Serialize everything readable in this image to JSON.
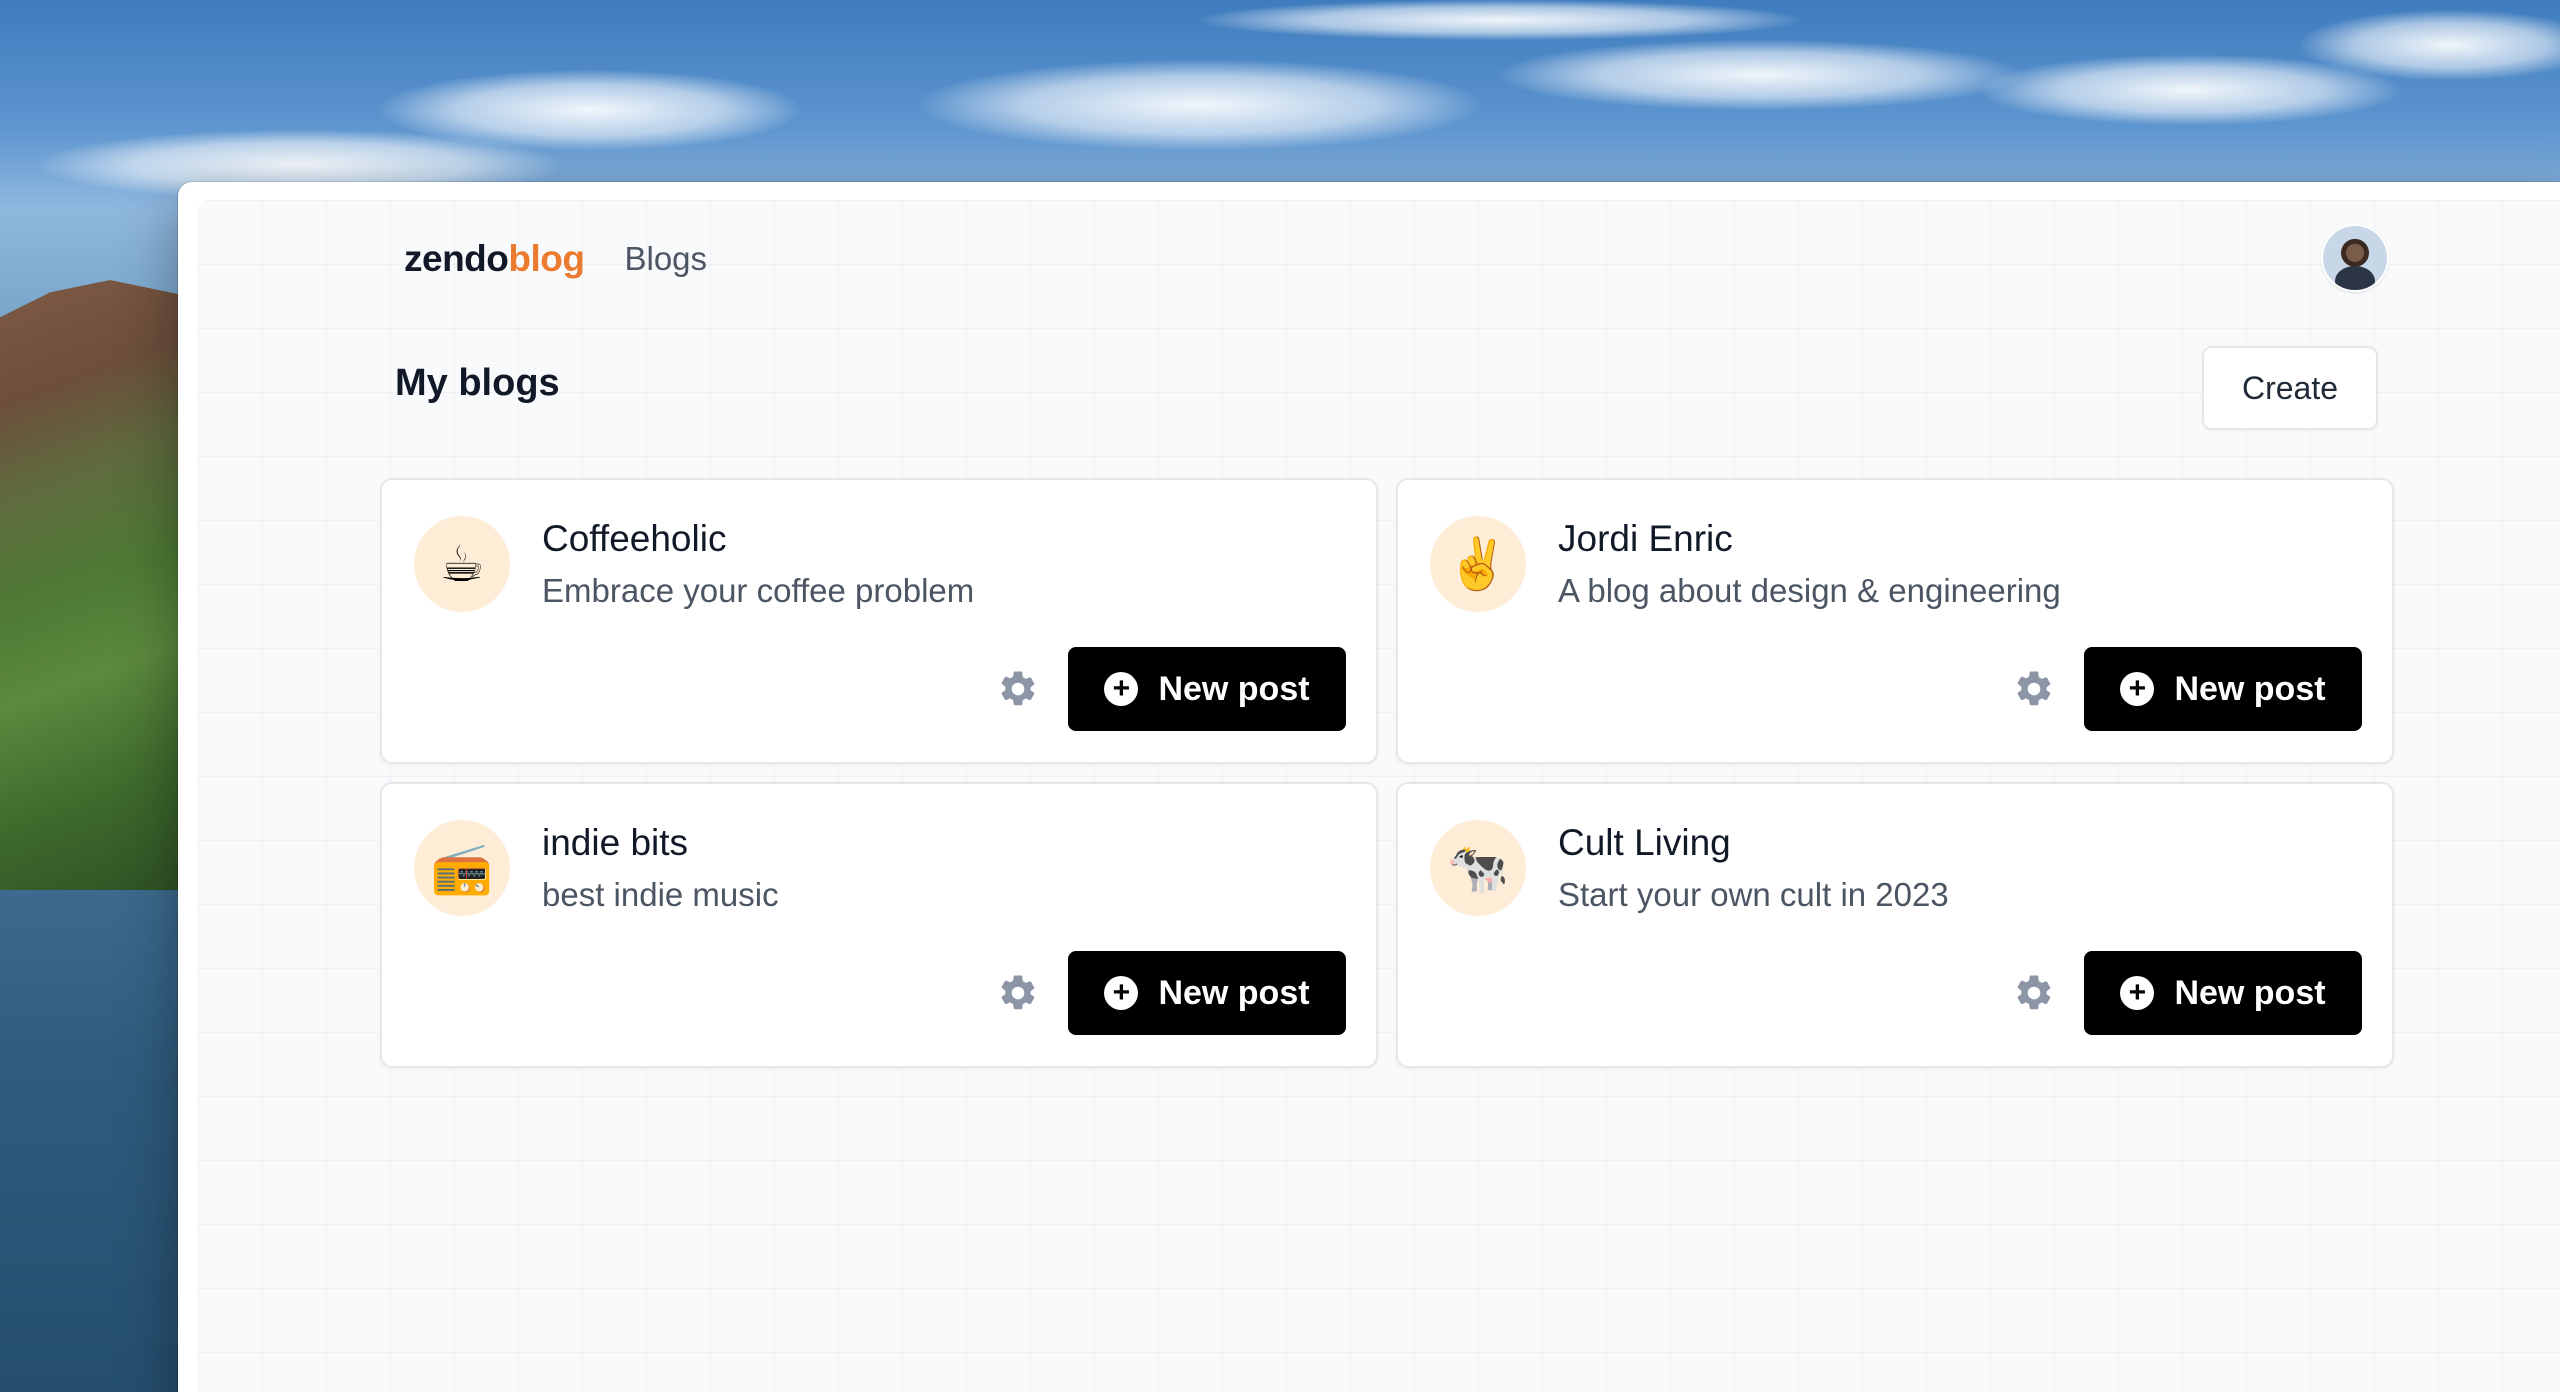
{
  "header": {
    "logo_part1": "zendo",
    "logo_part2": "blog",
    "nav_blogs": "Blogs"
  },
  "page": {
    "title": "My blogs",
    "create_label": "Create"
  },
  "blogs": [
    {
      "name": "Coffeeholic",
      "description": "Embrace your coffee problem",
      "emoji": "☕",
      "new_post_label": "New post"
    },
    {
      "name": "Jordi Enric",
      "description": "A blog about design & engineering",
      "emoji": "✌️",
      "new_post_label": "New post"
    },
    {
      "name": "indie bits",
      "description": "best indie music",
      "emoji": "📻",
      "new_post_label": "New post"
    },
    {
      "name": "Cult Living",
      "description": "Start your own cult in 2023",
      "emoji": "🐄",
      "new_post_label": "New post"
    }
  ],
  "icons": {
    "plus": "+"
  },
  "colors": {
    "accent": "#ea7b2f",
    "emoji_bg": "#fdecd6",
    "primary_button": "#000000"
  }
}
